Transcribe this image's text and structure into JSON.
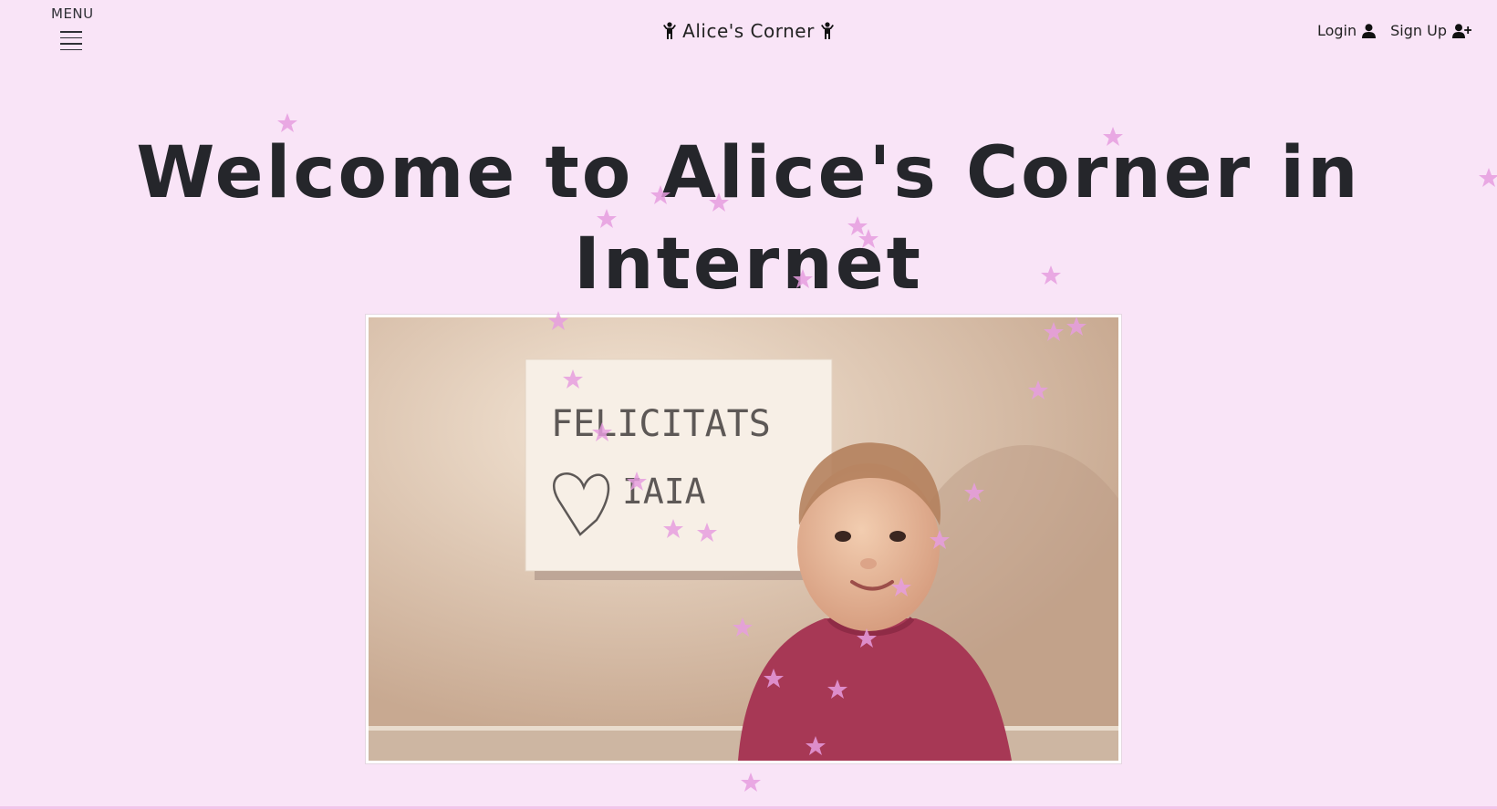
{
  "header": {
    "menu_label": "MENU",
    "brand_title": "Alice's Corner",
    "login_label": "Login",
    "signup_label": "Sign Up"
  },
  "hero": {
    "title": "Welcome to Alice's Corner in Internet",
    "photo_sign_line1": "FELICITATS",
    "photo_sign_line2": "IAIA"
  },
  "colors": {
    "background": "#f9e4f7",
    "star": "#e79ee0",
    "text": "#25262b"
  }
}
